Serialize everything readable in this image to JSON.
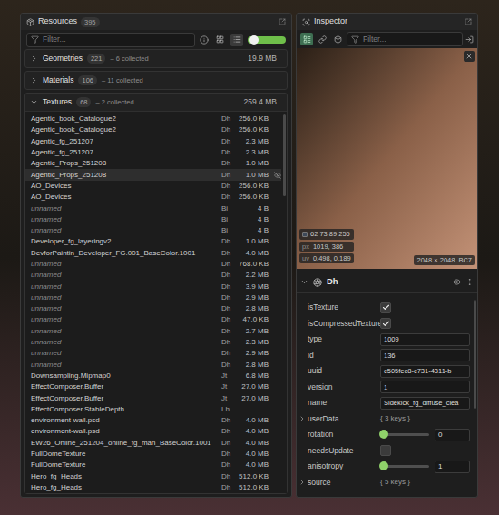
{
  "resources": {
    "title": "Resources",
    "count": "395",
    "filter_placeholder": "Filter...",
    "view_modes": [
      {
        "kind": "grid",
        "selected": false
      },
      {
        "kind": "list",
        "selected": true
      }
    ],
    "size_slider": {
      "level": 0.1
    },
    "sections": [
      {
        "name": "Geometries",
        "count": "221",
        "collected": "– 6 collected",
        "size": "19.9 MB",
        "expanded": false,
        "items": []
      },
      {
        "name": "Materials",
        "count": "106",
        "collected": "– 11 collected",
        "expanded": false,
        "items": []
      },
      {
        "name": "Textures",
        "count": "68",
        "collected": "– 2 collected",
        "size": "259.4 MB",
        "expanded": true,
        "items": [
          {
            "name": "Agentic_book_Catalogue2",
            "type": "Dh",
            "size": "256.0 KB",
            "unnamed": false,
            "hovered": false
          },
          {
            "name": "Agentic_book_Catalogue2",
            "type": "Dh",
            "size": "256.0 KB",
            "unnamed": false,
            "hovered": false
          },
          {
            "name": "Agentic_fg_251207",
            "type": "Dh",
            "size": "2.3 MB",
            "unnamed": false,
            "hovered": false
          },
          {
            "name": "Agentic_fg_251207",
            "type": "Dh",
            "size": "2.3 MB",
            "unnamed": false,
            "hovered": false
          },
          {
            "name": "Agentic_Props_251208",
            "type": "Dh",
            "size": "1.0 MB",
            "unnamed": false,
            "hovered": false
          },
          {
            "name": "Agentic_Props_251208",
            "type": "Dh",
            "size": "1.0 MB",
            "unnamed": false,
            "hovered": true
          },
          {
            "name": "AO_Devices",
            "type": "Dh",
            "size": "256.0 KB",
            "unnamed": false,
            "hovered": false
          },
          {
            "name": "AO_Devices",
            "type": "Dh",
            "size": "256.0 KB",
            "unnamed": false,
            "hovered": false
          },
          {
            "name": "unnamed",
            "type": "Bi",
            "size": "4 B",
            "unnamed": true,
            "hovered": false
          },
          {
            "name": "unnamed",
            "type": "Bi",
            "size": "4 B",
            "unnamed": true,
            "hovered": false
          },
          {
            "name": "unnamed",
            "type": "Bi",
            "size": "4 B",
            "unnamed": true,
            "hovered": false
          },
          {
            "name": "Developer_fg_layeringv2",
            "type": "Dh",
            "size": "1.0 MB",
            "unnamed": false,
            "hovered": false
          },
          {
            "name": "DevforPaintin_Developer_FG.001_BaseColor.1001",
            "type": "Dh",
            "size": "4.0 MB",
            "unnamed": false,
            "hovered": false
          },
          {
            "name": "unnamed",
            "type": "Dh",
            "size": "768.0 KB",
            "unnamed": true,
            "hovered": false
          },
          {
            "name": "unnamed",
            "type": "Dh",
            "size": "2.2 MB",
            "unnamed": true,
            "hovered": false
          },
          {
            "name": "unnamed",
            "type": "Dh",
            "size": "3.9 MB",
            "unnamed": true,
            "hovered": false
          },
          {
            "name": "unnamed",
            "type": "Dh",
            "size": "2.9 MB",
            "unnamed": true,
            "hovered": false
          },
          {
            "name": "unnamed",
            "type": "Dh",
            "size": "2.8 MB",
            "unnamed": true,
            "hovered": false
          },
          {
            "name": "unnamed",
            "type": "Dh",
            "size": "47.0 KB",
            "unnamed": true,
            "hovered": false
          },
          {
            "name": "unnamed",
            "type": "Dh",
            "size": "2.7 MB",
            "unnamed": true,
            "hovered": false
          },
          {
            "name": "unnamed",
            "type": "Dh",
            "size": "2.3 MB",
            "unnamed": true,
            "hovered": false
          },
          {
            "name": "unnamed",
            "type": "Dh",
            "size": "2.9 MB",
            "unnamed": true,
            "hovered": false
          },
          {
            "name": "unnamed",
            "type": "Dh",
            "size": "2.8 MB",
            "unnamed": true,
            "hovered": false
          },
          {
            "name": "Downsampling.Mipmap0",
            "type": "Jt",
            "size": "6.8 MB",
            "unnamed": false,
            "hovered": false
          },
          {
            "name": "EffectComposer.Buffer",
            "type": "Jt",
            "size": "27.0 MB",
            "unnamed": false,
            "hovered": false
          },
          {
            "name": "EffectComposer.Buffer",
            "type": "Jt",
            "size": "27.0 MB",
            "unnamed": false,
            "hovered": false
          },
          {
            "name": "EffectComposer.StableDepth",
            "type": "Lh",
            "unnamed": false,
            "hovered": false
          },
          {
            "name": "environment-wall.psd",
            "type": "Dh",
            "size": "4.0 MB",
            "unnamed": false,
            "hovered": false
          },
          {
            "name": "environment-wall.psd",
            "type": "Dh",
            "size": "4.0 MB",
            "unnamed": false,
            "hovered": false
          },
          {
            "name": "EW26_Online_251204_online_fg_man_BaseColor.1001",
            "type": "Dh",
            "size": "4.0 MB",
            "unnamed": false,
            "hovered": false
          },
          {
            "name": "FullDomeTexture",
            "type": "Dh",
            "size": "4.0 MB",
            "unnamed": false,
            "hovered": false
          },
          {
            "name": "FullDomeTexture",
            "type": "Dh",
            "size": "4.0 MB",
            "unnamed": false,
            "hovered": false
          },
          {
            "name": "Hero_fg_Heads",
            "type": "Dh",
            "size": "512.0 KB",
            "unnamed": false,
            "hovered": false
          },
          {
            "name": "Hero_fg_Heads",
            "type": "Dh",
            "size": "512.0 KB",
            "unnamed": false,
            "hovered": false
          }
        ]
      }
    ]
  },
  "inspector": {
    "title": "Inspector",
    "filter_placeholder": "Filter...",
    "tools": [
      {
        "kind": "properties",
        "selected": true
      },
      {
        "kind": "link",
        "selected": false
      },
      {
        "kind": "cube",
        "selected": false
      }
    ],
    "preview": {
      "pixel": "62 73 89 255",
      "pixel_color": "#3e4959",
      "px_label": "px",
      "px": "1019, 386",
      "uv_label": "uv",
      "uv": "0.498, 0.189",
      "dimensions": "2048 × 2048",
      "format": "BC7"
    },
    "object": {
      "name": "Dh",
      "properties": [
        {
          "label": "isTexture",
          "kind": "checkbox",
          "checked": true
        },
        {
          "label": "isCompressedTexture",
          "kind": "checkbox",
          "checked": true
        },
        {
          "label": "type",
          "kind": "field",
          "value": "1009"
        },
        {
          "label": "id",
          "kind": "field",
          "value": "136"
        },
        {
          "label": "uuid",
          "kind": "field",
          "value": "c505fec8-c731-4311-b"
        },
        {
          "label": "version",
          "kind": "field",
          "value": "1"
        },
        {
          "label": "name",
          "kind": "field",
          "value": "Sidekick_fg_diffuse_clea"
        },
        {
          "label": "userData",
          "kind": "object",
          "value": "{ 3 keys }",
          "expanded": false
        },
        {
          "label": "rotation",
          "kind": "slider",
          "level": 0,
          "value": "0"
        },
        {
          "label": "needsUpdate",
          "kind": "checkbox",
          "checked": false
        },
        {
          "label": "anisotropy",
          "kind": "slider",
          "level": 0,
          "value": "1"
        },
        {
          "label": "source",
          "kind": "object",
          "value": "{ 5 keys }",
          "expanded": false
        }
      ]
    }
  }
}
